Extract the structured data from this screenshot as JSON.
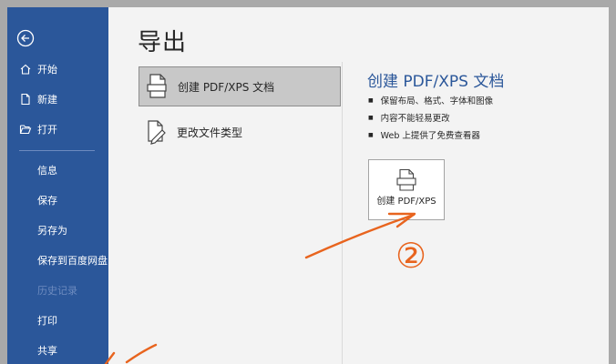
{
  "page": {
    "title": "导出"
  },
  "sidebar": {
    "items": [
      {
        "label": "开始"
      },
      {
        "label": "新建"
      },
      {
        "label": "打开"
      },
      {
        "label": "信息"
      },
      {
        "label": "保存"
      },
      {
        "label": "另存为"
      },
      {
        "label": "保存到百度网盘"
      },
      {
        "label": "历史记录",
        "disabled": true
      },
      {
        "label": "打印"
      },
      {
        "label": "共享"
      }
    ]
  },
  "options": [
    {
      "label": "创建 PDF/XPS 文档",
      "selected": true
    },
    {
      "label": "更改文件类型"
    }
  ],
  "detail": {
    "title": "创建 PDF/XPS 文档",
    "bullets": [
      "保留布局、格式、字体和图像",
      "内容不能轻易更改",
      "Web 上提供了免费查看器"
    ],
    "button_label": "创建 PDF/XPS"
  },
  "annotation": {
    "mark": "②",
    "color": "#e8641e"
  },
  "colors": {
    "accent": "#2b579a",
    "annotation": "#e8641e"
  }
}
